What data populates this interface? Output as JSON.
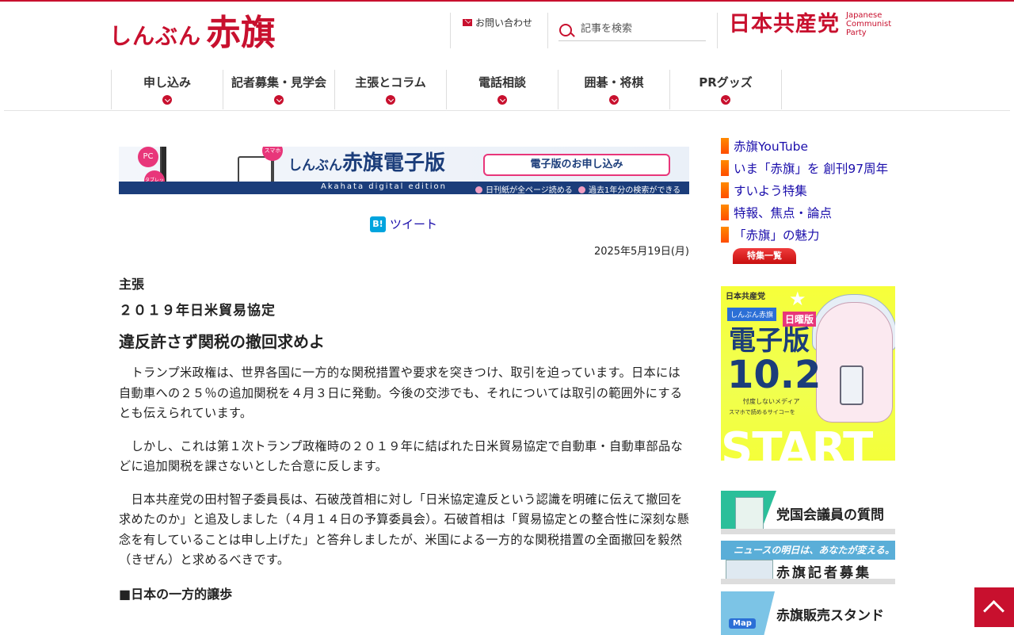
{
  "header": {
    "logo_small": "しんぶん",
    "logo_big": "赤旗",
    "contact_label": "お問い合わせ",
    "search_placeholder": "記事を検索",
    "party_jp": "日本共産党",
    "party_en_1": "Japanese",
    "party_en_2": "Communist",
    "party_en_3": "Party"
  },
  "nav": {
    "items": [
      {
        "label": "申し込み"
      },
      {
        "label": "記者募集・見学会"
      },
      {
        "label": "主張とコラム"
      },
      {
        "label": "電話相談"
      },
      {
        "label": "囲碁・将棋"
      },
      {
        "label": "PRグッズ"
      }
    ]
  },
  "banner": {
    "pc": "PC",
    "tablet": "タブレット",
    "smartphone": "スマホ",
    "title_small": "しんぶん",
    "title_big": "赤旗電子版",
    "subtitle": "Akahata digital edition",
    "button": "電子版のお申し込み",
    "feature1": "日刊紙が全ページ読める",
    "feature2": "過去1年分の検索ができる"
  },
  "share": {
    "hatena": "B!",
    "tweet": "ツイート"
  },
  "article": {
    "date": "2025年5月19日(月)",
    "kicker": "主張",
    "subhead": "２０１９年日米貿易協定",
    "headline": "違反許さず関税の撤回求めよ",
    "paragraphs": [
      "　トランプ米政権は、世界各国に一方的な関税措置や要求を突きつけ、取引を迫っています。日本には自動車への２５％の追加関税を４月３日に発動。今後の交渉でも、それについては取引の範囲外にするとも伝えられています。",
      "　しかし、これは第１次トランプ政権時の２０１９年に結ばれた日米貿易協定で自動車・自動車部品などに追加関税を課さないとした合意に反します。",
      "　日本共産党の田村智子委員長は、石破茂首相に対し「日米協定違反という認識を明確に伝えて撤回を求めたのか」と追及しました（４月１４日の予算委員会）。石破首相は「貿易協定との整合性に深刻な懸念を有していることは申し上げた」と答弁しましたが、米国による一方的な関税措置の全面撤回を毅然（きぜん）と求めるべきです。"
    ],
    "section_heading": "■日本の一方的譲歩"
  },
  "sidebar": {
    "links": [
      {
        "label": "赤旗YouTube"
      },
      {
        "label": "いま「赤旗」を 創刊97周年"
      },
      {
        "label": "すいよう特集"
      },
      {
        "label": "特報、焦点・論点"
      },
      {
        "label": "「赤旗」の魅力"
      }
    ],
    "feature_list_button": "特集一覧",
    "promo": {
      "party": "日本共産党",
      "badge1": "しんぶん赤旗",
      "badge2": "日曜版",
      "title": "電子版",
      "number": "10.2",
      "tagline": "忖度しないメディア",
      "tagline2": "スマホで読めるサイコーを",
      "start": "START"
    },
    "banner1": "党国会議員の質問",
    "banner2_top": "ニュースの明日は、あなたが変える。",
    "banner2": "赤旗記者募集",
    "banner3_map": "Map",
    "banner3": "赤旗販売スタンド"
  },
  "colors": {
    "brand_red": "#c8102e",
    "link_blue": "#1a0dab",
    "accent_orange": "#ff6a00"
  }
}
